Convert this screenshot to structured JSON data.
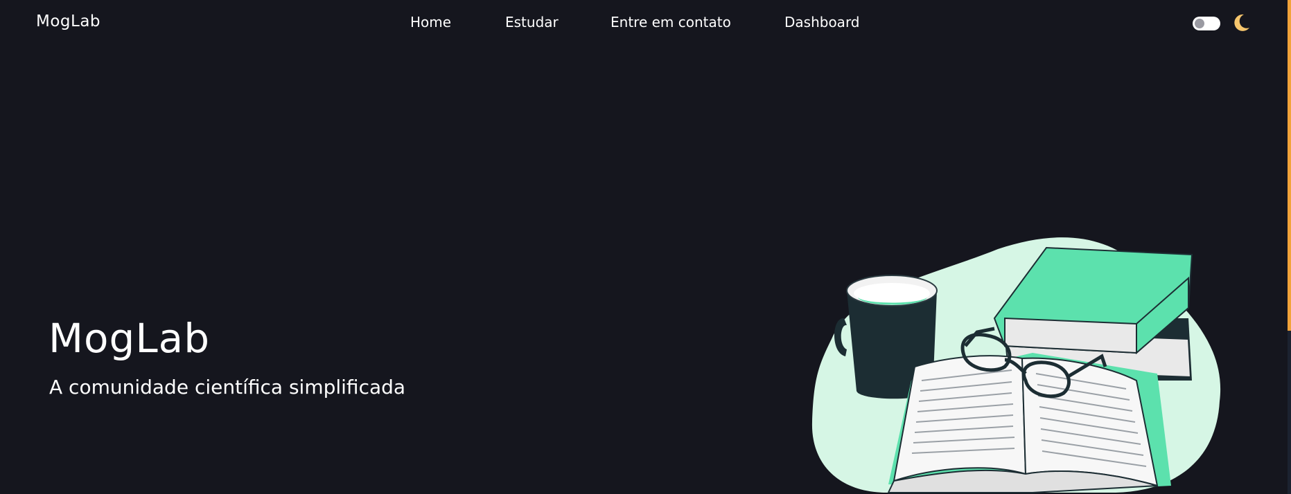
{
  "navbar": {
    "brand": "MogLab",
    "links": [
      "Home",
      "Estudar",
      "Entre em contato",
      "Dashboard"
    ],
    "theme_toggle": {
      "state": "off"
    },
    "theme_icon": "moon-icon"
  },
  "hero": {
    "title": "MogLab",
    "subtitle": "A comunidade científica simplificada",
    "illustration": "books-mug-glasses-illustration"
  },
  "colors": {
    "background": "#15161e",
    "accent_green": "#5ce1ad",
    "blob": "#d6f6e5",
    "moon": "#f6c66d",
    "scrollbar": "#f2a33a"
  },
  "scroll": {
    "position_fraction": 0.0,
    "thumb_fraction": 0.67
  }
}
